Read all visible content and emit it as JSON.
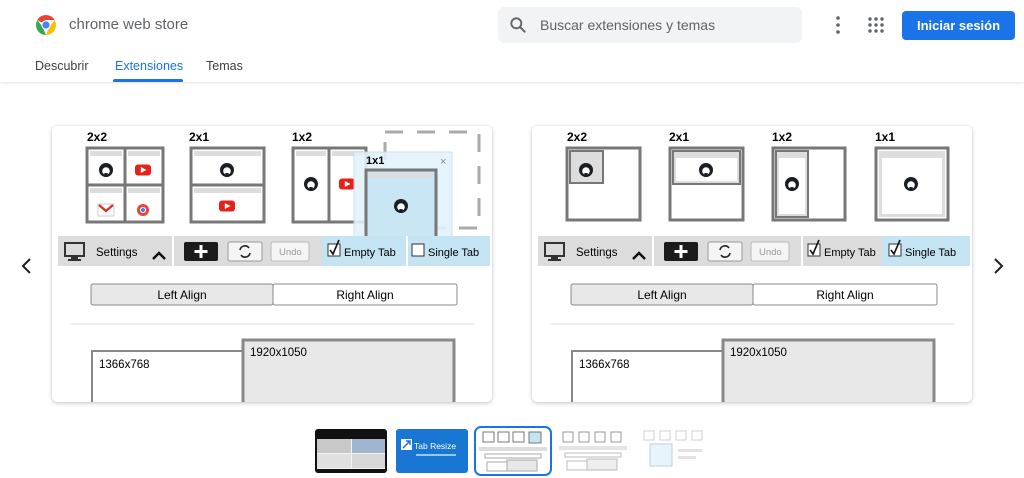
{
  "header": {
    "brand": "chrome web store",
    "search_placeholder": "Buscar extensiones y temas",
    "signin_label": "Iniciar sesión",
    "icons": [
      "chrome-logo",
      "search-icon",
      "more-vert-icon",
      "apps-grid-icon"
    ],
    "accent_color": "#1a73e8"
  },
  "nav": {
    "tabs": [
      {
        "label": "Descubrir",
        "active": false
      },
      {
        "label": "Extensiones",
        "active": true
      },
      {
        "label": "Temas",
        "active": false
      }
    ]
  },
  "carousel": {
    "prev_icon": "chevron-left-icon",
    "next_icon": "chevron-right-icon",
    "slides": [
      {
        "layouts": [
          "2x2",
          "2x1",
          "1x2"
        ],
        "drag_tile_label": "1x1",
        "drag_close": "×",
        "toolbar": {
          "settings": "Settings",
          "undo": "Undo",
          "empty_tab": "Empty Tab",
          "single_tab": "Single Tab",
          "empty_tab_checked": true,
          "single_tab_checked": false
        },
        "align": {
          "left": "Left Align",
          "right": "Right Align",
          "selected": "left"
        },
        "resolutions": [
          "1366x768",
          "1920x1050"
        ]
      },
      {
        "layouts": [
          "2x2",
          "2x1",
          "1x2",
          "1x1"
        ],
        "toolbar": {
          "settings": "Settings",
          "undo": "Undo",
          "empty_tab": "Empty Tab",
          "single_tab": "Single Tab",
          "empty_tab_checked": true,
          "single_tab_checked": true
        },
        "align": {
          "left": "Left Align",
          "right": "Right Align",
          "selected": "left"
        },
        "resolutions": [
          "1366x768",
          "1920x1050"
        ]
      }
    ]
  },
  "thumbnails": [
    {
      "label": "",
      "selected": false
    },
    {
      "label": "Tab Resize",
      "selected": false
    },
    {
      "label": "",
      "selected": true
    },
    {
      "label": "",
      "selected": false
    },
    {
      "label": "",
      "selected": false
    }
  ]
}
